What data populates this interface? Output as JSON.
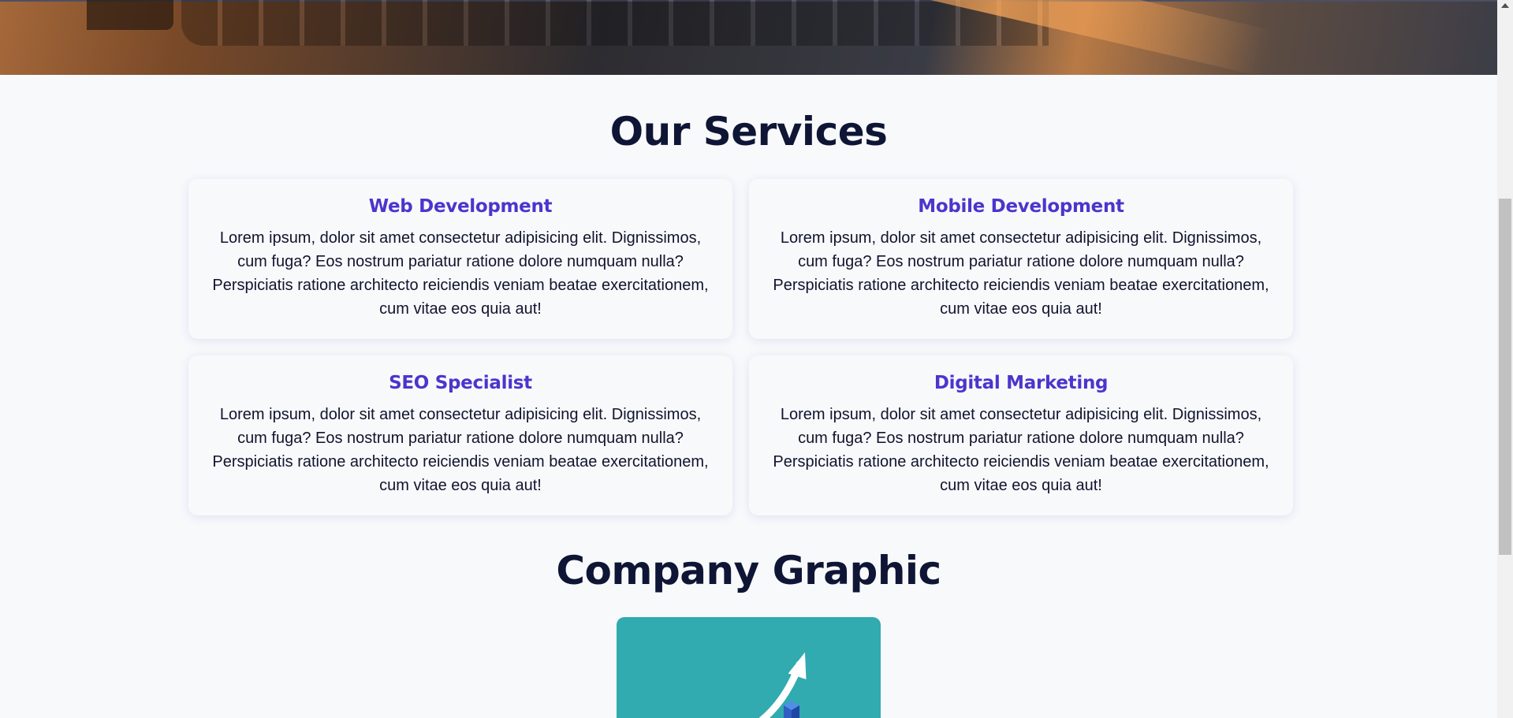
{
  "services": {
    "title": "Our Services",
    "cards": [
      {
        "title": "Web Development",
        "text": "Lorem ipsum, dolor sit amet consectetur adipisicing elit. Dignissimos, cum fuga? Eos nostrum pariatur ratione dolore numquam nulla? Perspiciatis ratione architecto reiciendis veniam beatae exercitationem, cum vitae eos quia aut!"
      },
      {
        "title": "Mobile Development",
        "text": "Lorem ipsum, dolor sit amet consectetur adipisicing elit. Dignissimos, cum fuga? Eos nostrum pariatur ratione dolore numquam nulla? Perspiciatis ratione architecto reiciendis veniam beatae exercitationem, cum vitae eos quia aut!"
      },
      {
        "title": "SEO Specialist",
        "text": "Lorem ipsum, dolor sit amet consectetur adipisicing elit. Dignissimos, cum fuga? Eos nostrum pariatur ratione dolore numquam nulla? Perspiciatis ratione architecto reiciendis veniam beatae exercitationem, cum vitae eos quia aut!"
      },
      {
        "title": "Digital Marketing",
        "text": "Lorem ipsum, dolor sit amet consectetur adipisicing elit. Dignissimos, cum fuga? Eos nostrum pariatur ratione dolore numquam nulla? Perspiciatis ratione architecto reiciendis veniam beatae exercitationem, cum vitae eos quia aut!"
      }
    ]
  },
  "graphic": {
    "title": "Company Graphic",
    "background_color": "#31aab0",
    "icon": "growth-arrow-icon"
  },
  "colors": {
    "accent": "#4b35cc",
    "heading": "#0f1534",
    "background": "#f8f9fb"
  }
}
